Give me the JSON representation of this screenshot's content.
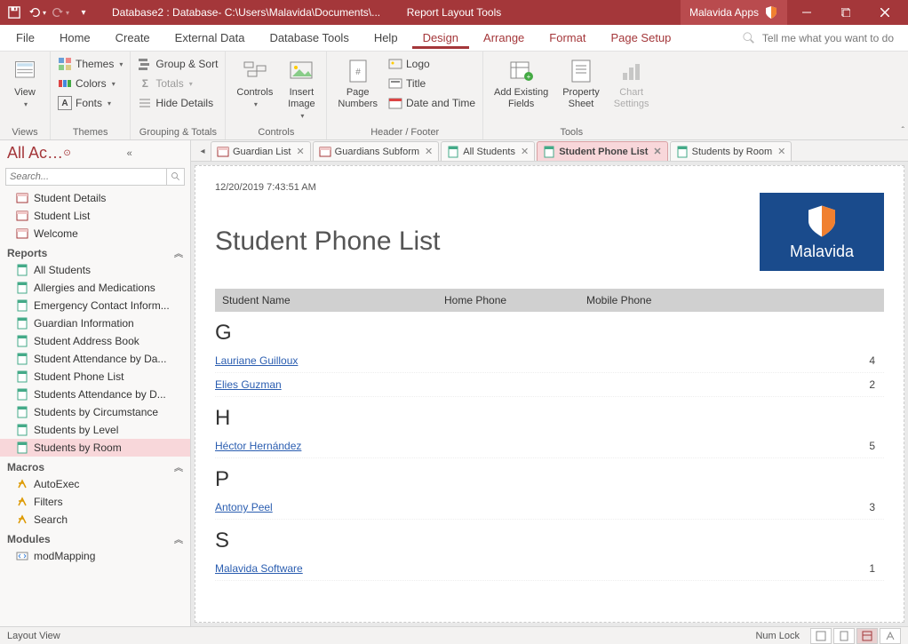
{
  "titlebar": {
    "title": "Database2 : Database- C:\\Users\\Malavida\\Documents\\...",
    "tools": "Report Layout Tools",
    "app": "Malavida Apps"
  },
  "menu": {
    "file": "File",
    "home": "Home",
    "create": "Create",
    "external": "External Data",
    "dbtools": "Database Tools",
    "help": "Help",
    "design": "Design",
    "arrange": "Arrange",
    "format": "Format",
    "pagesetup": "Page Setup",
    "tellme": "Tell me what you want to do"
  },
  "ribbon": {
    "views": {
      "label": "Views",
      "view": "View"
    },
    "themes": {
      "label": "Themes",
      "themes": "Themes",
      "colors": "Colors",
      "fonts": "Fonts"
    },
    "grouping": {
      "label": "Grouping & Totals",
      "groupsort": "Group & Sort",
      "totals": "Totals",
      "hide": "Hide Details"
    },
    "controls": {
      "label": "Controls",
      "controls": "Controls",
      "insertimg": "Insert\nImage"
    },
    "headerfooter": {
      "label": "Header / Footer",
      "pageno": "Page\nNumbers",
      "logo": "Logo",
      "title": "Title",
      "datetime": "Date and Time"
    },
    "tools": {
      "label": "Tools",
      "addfields": "Add Existing\nFields",
      "propsheet": "Property\nSheet",
      "chart": "Chart\nSettings"
    }
  },
  "nav": {
    "header": "All Access Obje…",
    "search_ph": "Search...",
    "forms": [
      "Student Details",
      "Student List",
      "Welcome"
    ],
    "reports_label": "Reports",
    "reports": [
      "All Students",
      "Allergies and Medications",
      "Emergency Contact Inform...",
      "Guardian Information",
      "Student Address Book",
      "Student Attendance by Da...",
      "Student Phone List",
      "Students Attendance by D...",
      "Students by Circumstance",
      "Students by Level",
      "Students by Room"
    ],
    "macros_label": "Macros",
    "macros": [
      "AutoExec",
      "Filters",
      "Search"
    ],
    "modules_label": "Modules",
    "modules": [
      "modMapping"
    ],
    "selected": "Students by Room"
  },
  "tabs": [
    {
      "label": "Guardian List",
      "type": "form"
    },
    {
      "label": "Guardians Subform",
      "type": "form"
    },
    {
      "label": "All Students",
      "type": "report"
    },
    {
      "label": "Student Phone List",
      "type": "report",
      "active": true
    },
    {
      "label": "Students by Room",
      "type": "report"
    }
  ],
  "report": {
    "timestamp": "12/20/2019 7:43:51 AM",
    "title": "Student Phone List",
    "logo_text": "Malavida",
    "cols": {
      "c1": "Student Name",
      "c2": "Home Phone",
      "c3": "Mobile Phone"
    },
    "groups": [
      {
        "letter": "G",
        "rows": [
          {
            "name": "Lauriane Guilloux",
            "n": "4"
          },
          {
            "name": "Elies Guzman",
            "n": "2"
          }
        ]
      },
      {
        "letter": "H",
        "rows": [
          {
            "name": "Héctor Hernández",
            "n": "5"
          }
        ]
      },
      {
        "letter": "P",
        "rows": [
          {
            "name": "Antony Peel",
            "n": "3"
          }
        ]
      },
      {
        "letter": "S",
        "rows": [
          {
            "name": "Malavida Software",
            "n": "1"
          }
        ]
      }
    ]
  },
  "status": {
    "view": "Layout View",
    "numlock": "Num Lock"
  }
}
